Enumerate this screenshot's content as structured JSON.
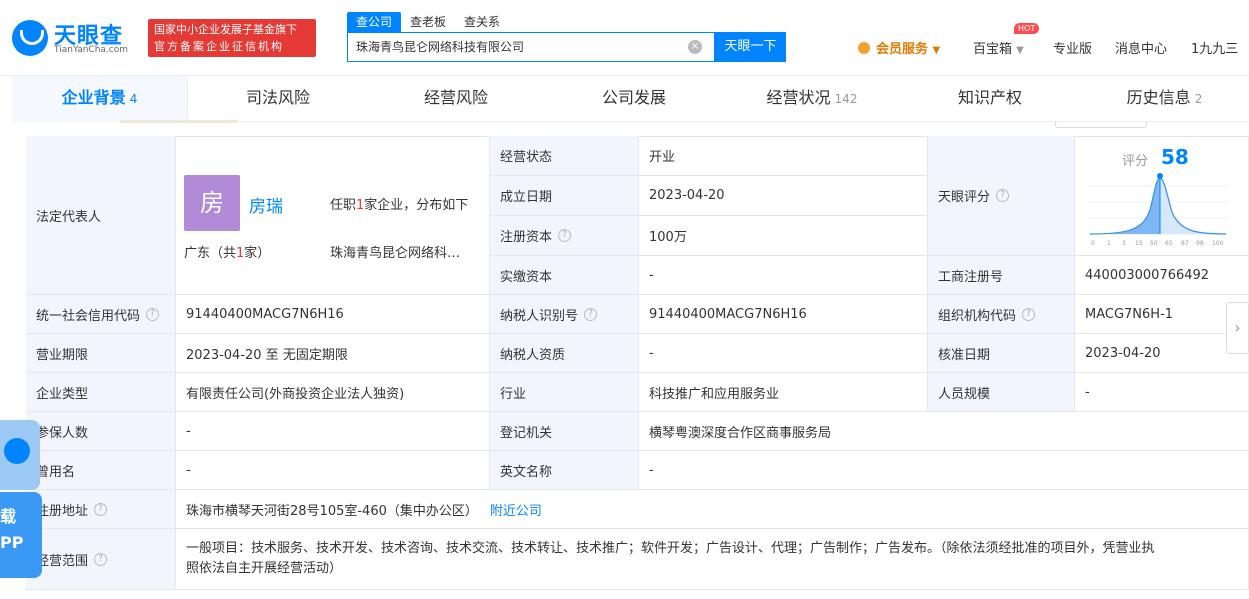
{
  "header": {
    "logo_text": "天眼查",
    "logo_sub": "TianYanCha.com",
    "badge_line1": "国家中小企业发展子基金旗下",
    "badge_line2": "官方备案企业征信机构",
    "search_tabs": [
      "查公司",
      "查老板",
      "查关系"
    ],
    "search_value": "珠海青鸟昆仑网络科技有限公司",
    "clear_icon": "×",
    "search_button": "天眼一下",
    "vip": "会员服务",
    "hot": "HOT",
    "baibaoxiang": "百宝箱",
    "pro": "专业版",
    "messages": "消息中心",
    "user": "1九九三"
  },
  "tabs": [
    {
      "label": "企业背景",
      "count": "4"
    },
    {
      "label": "司法风险",
      "count": ""
    },
    {
      "label": "经营风险",
      "count": ""
    },
    {
      "label": "公司发展",
      "count": ""
    },
    {
      "label": "经营状况",
      "count": "142"
    },
    {
      "label": "知识产权",
      "count": ""
    },
    {
      "label": "历史信息",
      "count": "2"
    }
  ],
  "table": {
    "legal_rep_label": "法定代表人",
    "avatar_char": "房",
    "person_name": "房瑞",
    "role_prefix": "任职",
    "role_count": "1",
    "role_suffix": "家企业，分布如下",
    "region_prefix": "广东（共",
    "region_count": "1",
    "region_suffix": "家）",
    "person_company": "珠海青鸟昆仑网络科…",
    "status_label": "经营状态",
    "status_value": "开业",
    "founded_label": "成立日期",
    "founded_value": "2023-04-20",
    "reg_capital_label": "注册资本",
    "reg_capital_value": "100万",
    "paid_capital_label": "实缴资本",
    "paid_capital_value": "-",
    "score_cell_label": "天眼评分",
    "score_label": "评分",
    "score_value": "58",
    "chart_ticks": [
      "0",
      "1",
      "3",
      "15",
      "50",
      "65",
      "87",
      "98",
      "100"
    ],
    "reg_no_label": "工商注册号",
    "reg_no_value": "440003000766492",
    "credit_code_label": "统一社会信用代码",
    "credit_code_value": "91440400MACG7N6H16",
    "taxpayer_id_label": "纳税人识别号",
    "taxpayer_id_value": "91440400MACG7N6H16",
    "org_code_label": "组织机构代码",
    "org_code_value": "MACG7N6H-1",
    "term_label": "营业期限",
    "term_value": "2023-04-20 至 无固定期限",
    "taxpayer_qual_label": "纳税人资质",
    "taxpayer_qual_value": "-",
    "approved_label": "核准日期",
    "approved_value": "2023-04-20",
    "type_label": "企业类型",
    "type_value": "有限责任公司(外商投资企业法人独资)",
    "industry_label": "行业",
    "industry_value": "科技推广和应用服务业",
    "staff_label": "人员规模",
    "staff_value": "-",
    "insured_label": "参保人数",
    "insured_value": "-",
    "authority_label": "登记机关",
    "authority_value": "横琴粤澳深度合作区商事服务局",
    "former_name_label": "曾用名",
    "former_name_value": "-",
    "english_name_label": "英文名称",
    "english_name_value": "-",
    "address_label": "注册地址",
    "address_value": "珠海市横琴天河街28号105室-460（集中办公区）",
    "nearby_link": "附近公司",
    "scope_label": "经营范围",
    "scope_line1": "一般项目：技术服务、技术开发、技术咨询、技术交流、技术转让、技术推广；软件开发；广告设计、代理；广告制作；广告发布。（除依法须经批准的项目外，凭营业执",
    "scope_line2": "照依法自主开展经营活动）"
  },
  "float": {
    "app_line1": "载",
    "app_line2": "PP",
    "arrow": "›"
  }
}
